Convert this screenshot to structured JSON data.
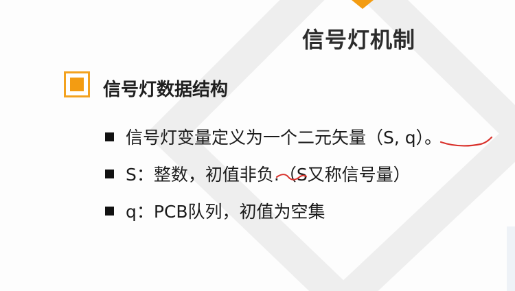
{
  "slide": {
    "title": "信号灯机制",
    "section_heading": "信号灯数据结构",
    "bullets": [
      {
        "text": "信号灯变量定义为一个二元矢量（S, q）。"
      },
      {
        "text": "S：整数，初值非负.（S又称信号量）"
      },
      {
        "text": "q：PCB队列，初值为空集"
      }
    ]
  },
  "colors": {
    "accent_orange": "#f39c12",
    "annotation_red": "#d9312b",
    "text_dark": "#1a1a1a"
  },
  "icons": {
    "section_icon": "orange-square-icon",
    "bullet_icon": "black-square-bullet-icon"
  }
}
